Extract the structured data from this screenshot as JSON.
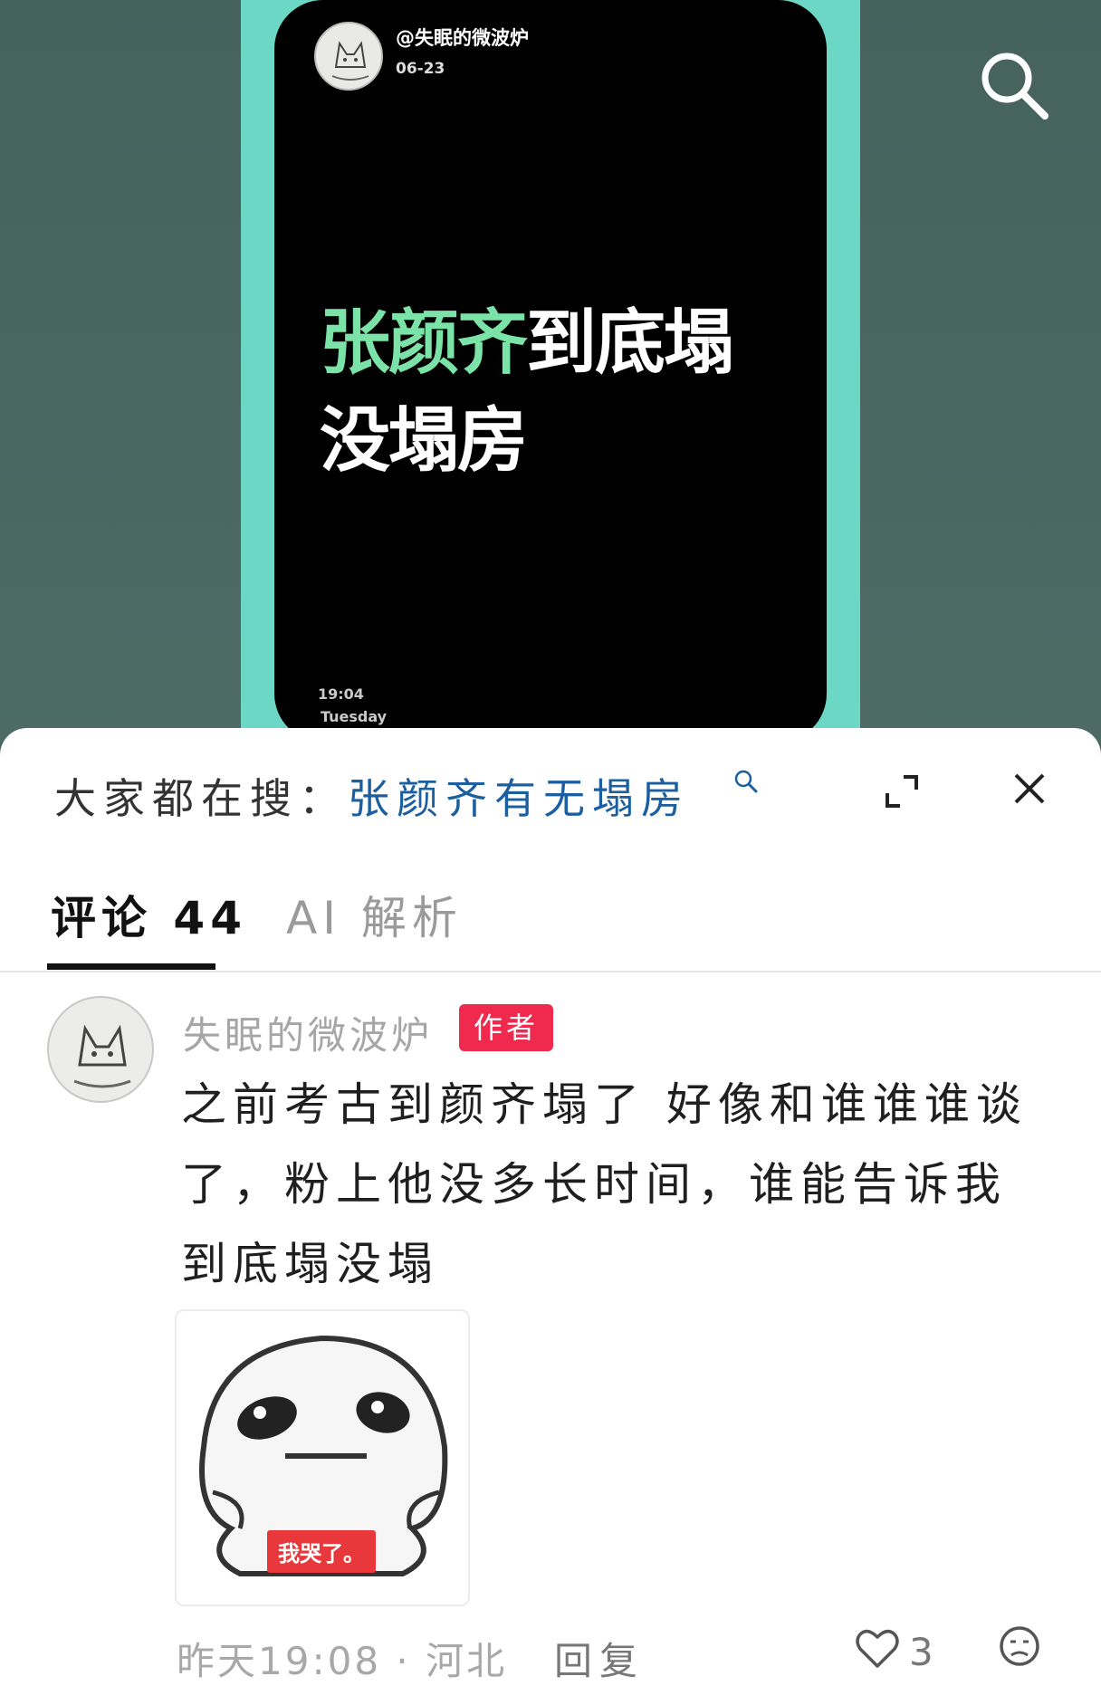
{
  "video": {
    "username": "@失眠的微波炉",
    "date": "06-23",
    "title_highlight": "张颜齐",
    "title_rest": "到底塌没塌房",
    "clock_time": "19:04",
    "clock_day": "Tuesday",
    "accent_color": "#7be3a8",
    "frame_color": "#6dd7c5"
  },
  "sheet": {
    "hot_search_label": "大家都在搜：",
    "hot_search_query": "张颜齐有无塌房",
    "tabs": [
      {
        "label": "评论 44",
        "active": true
      },
      {
        "label": "AI 解析",
        "active": false
      }
    ]
  },
  "comment": {
    "username": "失眠的微波炉",
    "badge": "作者",
    "badge_color": "#f0294f",
    "text": "之前考古到颜齐塌了 好像和谁谁谁谈了，粉上他没多长时间，谁能告诉我到底塌没塌",
    "sticker_caption": "我哭了。",
    "meta": "昨天19:08 · 河北",
    "reply_label": "回复",
    "like_count": "3"
  }
}
